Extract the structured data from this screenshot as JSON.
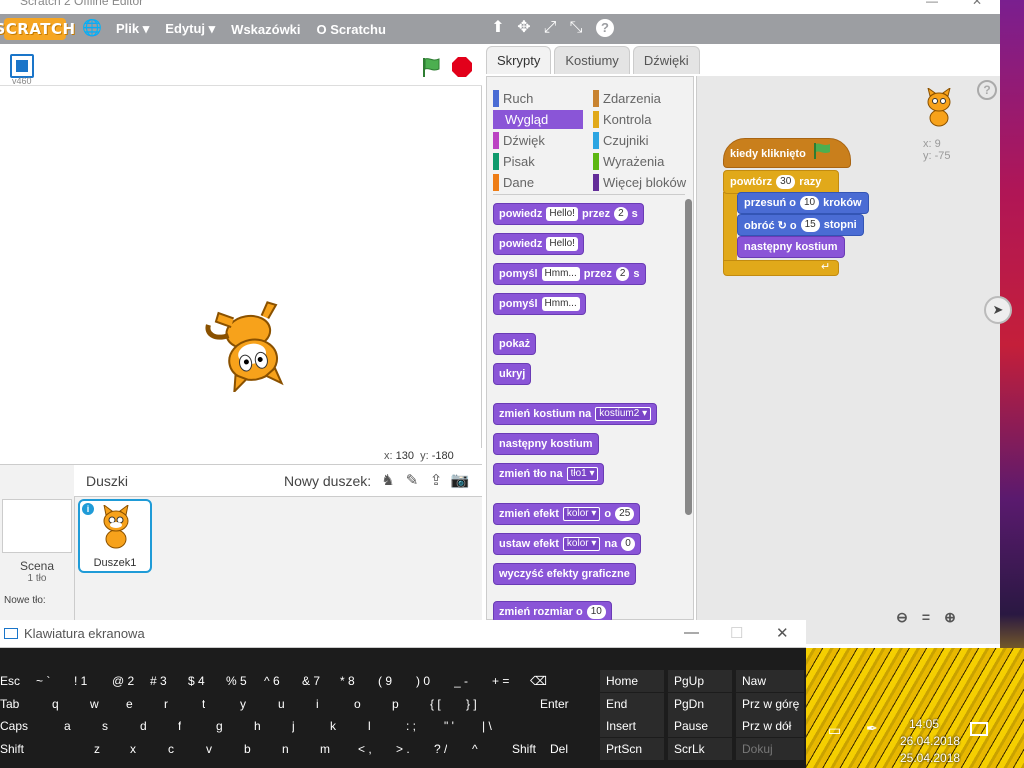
{
  "window": {
    "title": "Scratch 2 Offline Editor",
    "min": "—",
    "close": "✕"
  },
  "menubar": {
    "logo": "SCRATCH",
    "items": [
      "Plik",
      "Edytuj",
      "Wskazówki",
      "O Scratchu"
    ],
    "arrows": [
      "▾",
      "▾"
    ],
    "tool_icons": [
      "stamp-icon",
      "grow-icon",
      "shrink-icon",
      "help-icon"
    ]
  },
  "stage": {
    "version": "v460",
    "coords_x_label": "x:",
    "coords_x": "130",
    "coords_y_label": "y:",
    "coords_y": "-180"
  },
  "sprites": {
    "title": "Duszki",
    "new_sprite_label": "Nowy duszek:",
    "scene_label": "Scena",
    "scene_count": "1 tło",
    "new_bg_label": "Nowe tło:",
    "sprite_name": "Duszek1"
  },
  "tabs": [
    "Skrypty",
    "Kostiumy",
    "Dźwięki"
  ],
  "categories": [
    {
      "label": "Ruch",
      "color": "#4a6cd4"
    },
    {
      "label": "Zdarzenia",
      "color": "#c88330"
    },
    {
      "label": "Wygląd",
      "color": "#8a55d7"
    },
    {
      "label": "Kontrola",
      "color": "#e1a91a"
    },
    {
      "label": "Dźwięk",
      "color": "#bb42c3"
    },
    {
      "label": "Czujniki",
      "color": "#2ca5e2"
    },
    {
      "label": "Pisak",
      "color": "#0e9a6c"
    },
    {
      "label": "Wyrażenia",
      "color": "#5cb712"
    },
    {
      "label": "Dane",
      "color": "#ee7d16"
    },
    {
      "label": "Więcej bloków",
      "color": "#632d99"
    }
  ],
  "palette_blocks": {
    "say_for": {
      "a": "powiedz",
      "slot": "Hello!",
      "b": "przez",
      "num": "2",
      "c": "s"
    },
    "say": {
      "a": "powiedz",
      "slot": "Hello!"
    },
    "think_for": {
      "a": "pomyśl",
      "slot": "Hmm...",
      "b": "przez",
      "num": "2",
      "c": "s"
    },
    "think": {
      "a": "pomyśl",
      "slot": "Hmm..."
    },
    "show": "pokaż",
    "hide": "ukryj",
    "switch_costume": {
      "a": "zmień kostium na",
      "dd": "kostium2 ▾"
    },
    "next_costume": "następny kostium",
    "switch_backdrop": {
      "a": "zmień tło na",
      "dd": "tło1 ▾"
    },
    "change_effect": {
      "a": "zmień efekt",
      "dd": "kolor ▾",
      "b": "o",
      "num": "25"
    },
    "set_effect": {
      "a": "ustaw efekt",
      "dd": "kolor ▾",
      "b": "na",
      "num": "0"
    },
    "clear_effects": "wyczyść efekty graficzne",
    "change_size": {
      "a": "zmień rozmiar o",
      "num": "10"
    }
  },
  "script": {
    "hat": "kiedy kliknięto",
    "repeat": {
      "a": "powtórz",
      "num": "30",
      "b": "razy"
    },
    "move": {
      "a": "przesuń o",
      "num": "10",
      "b": "kroków"
    },
    "turn": {
      "a": "obróć ↻ o",
      "num": "15",
      "b": "stopni"
    },
    "next_costume": "następny kostium",
    "repeat_arrow": "↵"
  },
  "canvas_info": {
    "x": "x: 9",
    "y": "y: -75"
  },
  "osk": {
    "title": "Klawiatura ekranowa",
    "row1": [
      {
        "k": "Esc"
      },
      {
        "k": "~ `"
      },
      {
        "k": "! 1"
      },
      {
        "k": "@ 2"
      },
      {
        "k": "# 3"
      },
      {
        "k": "$ 4"
      },
      {
        "k": "% 5"
      },
      {
        "k": "^ 6"
      },
      {
        "k": "& 7"
      },
      {
        "k": "* 8"
      },
      {
        "k": "( 9"
      },
      {
        "k": ") 0"
      },
      {
        "k": "_ -"
      },
      {
        "k": "+ ="
      },
      {
        "k": "⌫"
      }
    ],
    "row2": [
      {
        "k": "Tab"
      },
      {
        "k": "q"
      },
      {
        "k": "w"
      },
      {
        "k": "e"
      },
      {
        "k": "r"
      },
      {
        "k": "t"
      },
      {
        "k": "y"
      },
      {
        "k": "u"
      },
      {
        "k": "i"
      },
      {
        "k": "o"
      },
      {
        "k": "p"
      },
      {
        "k": "{ ["
      },
      {
        "k": "} ]"
      },
      {
        "k": "Enter"
      }
    ],
    "row3": [
      {
        "k": "Caps"
      },
      {
        "k": "a"
      },
      {
        "k": "s"
      },
      {
        "k": "d"
      },
      {
        "k": "f"
      },
      {
        "k": "g"
      },
      {
        "k": "h"
      },
      {
        "k": "j"
      },
      {
        "k": "k"
      },
      {
        "k": "l"
      },
      {
        "k": ": ;"
      },
      {
        "k": "\" '"
      },
      {
        "k": "| \\"
      }
    ],
    "row4": [
      {
        "k": "Shift"
      },
      {
        "k": "z"
      },
      {
        "k": "x"
      },
      {
        "k": "c"
      },
      {
        "k": "v"
      },
      {
        "k": "b"
      },
      {
        "k": "n"
      },
      {
        "k": "m"
      },
      {
        "k": "< ,"
      },
      {
        "k": "> ."
      },
      {
        "k": "? /"
      },
      {
        "k": "^"
      },
      {
        "k": "Shift"
      },
      {
        "k": "Del"
      }
    ],
    "nav": [
      [
        "Home",
        "PgUp",
        "Naw"
      ],
      [
        "End",
        "PgDn",
        "Prz w górę"
      ],
      [
        "Insert",
        "Pause",
        "Prz w dół"
      ],
      [
        "PrtScn",
        "ScrLk",
        "Dokuj"
      ]
    ],
    "ghost_row": [
      "Caps",
      "a",
      "s",
      "d",
      "f",
      "g",
      "h",
      "j",
      "k",
      "l",
      "Insert",
      "Pause",
      "Prz w dół"
    ]
  },
  "taskbar": {
    "time": "14:05",
    "date": "26.04.2018",
    "date2": "25.04.2018"
  }
}
